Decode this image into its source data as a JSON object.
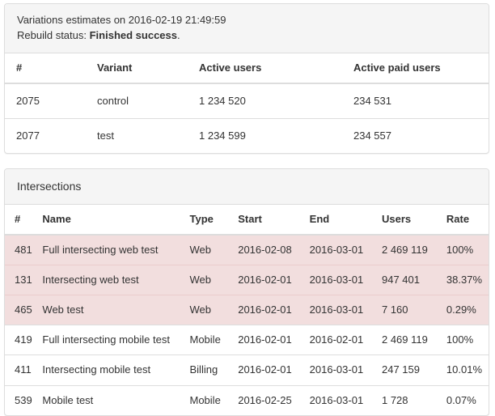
{
  "variations_panel": {
    "heading": {
      "line1": "Variations estimates on 2016-02-19 21:49:59",
      "status_label": "Rebuild status: ",
      "status_value": "Finished success",
      "status_suffix": "."
    },
    "table": {
      "columns": [
        "#",
        "Variant",
        "Active users",
        "Active paid users"
      ],
      "rows": [
        {
          "num": "2075",
          "variant": "control",
          "active_users": "1 234 520",
          "active_paid_users": "234 531"
        },
        {
          "num": "2077",
          "variant": "test",
          "active_users": "1 234 599",
          "active_paid_users": "234 557"
        }
      ]
    }
  },
  "intersections_panel": {
    "title": "Intersections",
    "table": {
      "columns": [
        "#",
        "Name",
        "Type",
        "Start",
        "End",
        "Users",
        "Rate"
      ],
      "rows": [
        {
          "num": "481",
          "name": "Full intersecting web test",
          "type": "Web",
          "start": "2016-02-08",
          "end": "2016-03-01",
          "users": "2 469 119",
          "rate": "100%",
          "highlight": true
        },
        {
          "num": "131",
          "name": "Intersecting web test",
          "type": "Web",
          "start": "2016-02-01",
          "end": "2016-03-01",
          "users": "947 401",
          "rate": "38.37%",
          "highlight": true
        },
        {
          "num": "465",
          "name": "Web test",
          "type": "Web",
          "start": "2016-02-01",
          "end": "2016-03-01",
          "users": "7 160",
          "rate": "0.29%",
          "highlight": true
        },
        {
          "num": "419",
          "name": "Full intersecting mobile test",
          "type": "Mobile",
          "start": "2016-02-01",
          "end": "2016-02-01",
          "users": "2 469 119",
          "rate": "100%",
          "highlight": false
        },
        {
          "num": "411",
          "name": "Intersecting mobile test",
          "type": "Billing",
          "start": "2016-02-01",
          "end": "2016-03-01",
          "users": "247 159",
          "rate": "10.01%",
          "highlight": false
        },
        {
          "num": "539",
          "name": "Mobile test",
          "type": "Mobile",
          "start": "2016-02-25",
          "end": "2016-03-01",
          "users": "1 728",
          "rate": "0.07%",
          "highlight": false
        }
      ]
    }
  },
  "colors": {
    "panel_border": "#dddddd",
    "panel_heading_bg": "#f5f5f5",
    "danger_row_bg": "#f2dede",
    "text": "#333333"
  }
}
